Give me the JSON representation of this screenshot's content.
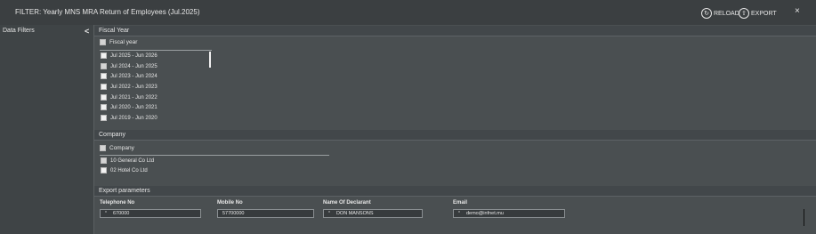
{
  "header": {
    "title": "FILTER: Yearly MNS MRA Return of Employees (Jul.2025)",
    "reload_label": "RELOAD",
    "export_label": "EXPORT",
    "close_glyph": "×"
  },
  "sidebar": {
    "title": "Data Filters",
    "collapse_glyph": "<"
  },
  "fiscal_year": {
    "section_title": "Fiscal Year",
    "group_label": "Fiscal year",
    "items": [
      {
        "label": "Jul 2025 - Jun 2026",
        "checked": false
      },
      {
        "label": "Jul 2024 - Jun 2025",
        "checked": true
      },
      {
        "label": "Jul 2023 - Jun 2024",
        "checked": false
      },
      {
        "label": "Jul 2022 - Jun 2023",
        "checked": false
      },
      {
        "label": "Jul 2021 - Jun 2022",
        "checked": false
      },
      {
        "label": "Jul 2020 - Jun 2021",
        "checked": false
      },
      {
        "label": "Jul 2019 - Jun 2020",
        "checked": false
      }
    ]
  },
  "company": {
    "section_title": "Company",
    "group_label": "Company",
    "items": [
      {
        "label": "10 General Co Ltd",
        "checked": true
      },
      {
        "label": "02 Hotel Co Ltd",
        "checked": false
      }
    ]
  },
  "export_parameters": {
    "section_title": "Export parameters",
    "fields": [
      {
        "label": "Telephone No",
        "value": "670000",
        "required_mark": "*"
      },
      {
        "label": "Mobile No",
        "value": "57700000",
        "required_mark": ""
      },
      {
        "label": "Name Of Declarant",
        "value": "DON MANSONS",
        "required_mark": "*"
      },
      {
        "label": "Email",
        "value": "demo@infnet.mu",
        "required_mark": "*"
      }
    ]
  },
  "colors": {
    "background": "#4a4f51",
    "titlebar": "#3b3f41",
    "text": "#e6e6e6",
    "checkbox": "#f2f2f2"
  }
}
